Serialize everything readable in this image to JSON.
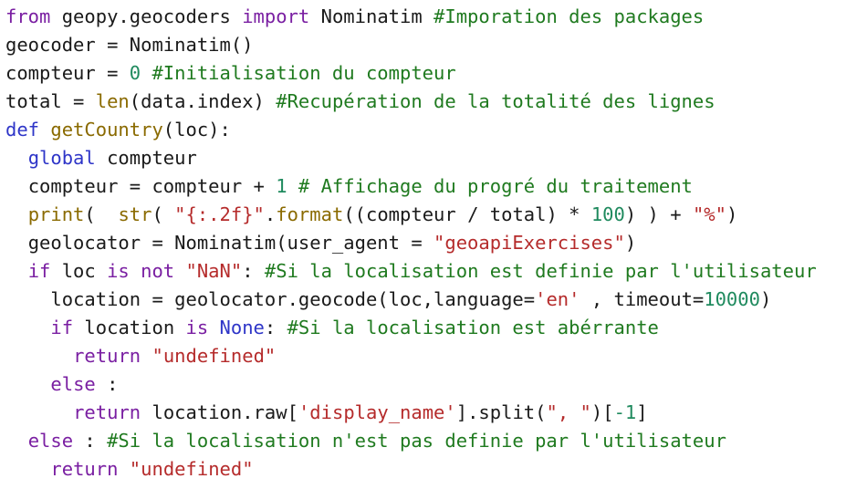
{
  "colors": {
    "plain": "#1a1a1a",
    "keyword": "#7a1fa2",
    "keyword2": "#2e35c8",
    "function": "#8a6a00",
    "string": "#b52b2b",
    "number": "#1f8a5e",
    "comment": "#1f7a1f"
  },
  "lines": [
    {
      "indent": 0,
      "tokens": [
        {
          "t": "kw",
          "v": "from"
        },
        {
          "t": "plain",
          "v": " geopy.geocoders "
        },
        {
          "t": "kw",
          "v": "import"
        },
        {
          "t": "plain",
          "v": " Nominatim "
        },
        {
          "t": "comment",
          "v": "#Imporation des packages"
        }
      ]
    },
    {
      "indent": 0,
      "tokens": [
        {
          "t": "plain",
          "v": "geocoder = Nominatim()"
        }
      ]
    },
    {
      "indent": 0,
      "tokens": [
        {
          "t": "plain",
          "v": "compteur = "
        },
        {
          "t": "num",
          "v": "0"
        },
        {
          "t": "plain",
          "v": " "
        },
        {
          "t": "comment",
          "v": "#Initialisation du compteur"
        }
      ]
    },
    {
      "indent": 0,
      "tokens": [
        {
          "t": "plain",
          "v": "total = "
        },
        {
          "t": "fn",
          "v": "len"
        },
        {
          "t": "plain",
          "v": "(data.index) "
        },
        {
          "t": "comment",
          "v": "#Recupération de la totalité des lignes"
        }
      ]
    },
    {
      "indent": 0,
      "tokens": [
        {
          "t": "kw2",
          "v": "def"
        },
        {
          "t": "plain",
          "v": " "
        },
        {
          "t": "fn",
          "v": "getCountry"
        },
        {
          "t": "plain",
          "v": "(loc):"
        }
      ]
    },
    {
      "indent": 1,
      "tokens": [
        {
          "t": "kw2",
          "v": "global"
        },
        {
          "t": "plain",
          "v": " compteur"
        }
      ]
    },
    {
      "indent": 1,
      "tokens": [
        {
          "t": "plain",
          "v": "compteur = compteur + "
        },
        {
          "t": "num",
          "v": "1"
        },
        {
          "t": "plain",
          "v": " "
        },
        {
          "t": "comment",
          "v": "# Affichage du progré du traitement"
        }
      ]
    },
    {
      "indent": 1,
      "tokens": [
        {
          "t": "fn",
          "v": "print"
        },
        {
          "t": "plain",
          "v": "(  "
        },
        {
          "t": "fn",
          "v": "str"
        },
        {
          "t": "plain",
          "v": "( "
        },
        {
          "t": "str",
          "v": "\"{:.2f}\""
        },
        {
          "t": "plain",
          "v": "."
        },
        {
          "t": "fn",
          "v": "format"
        },
        {
          "t": "plain",
          "v": "((compteur / total) * "
        },
        {
          "t": "num",
          "v": "100"
        },
        {
          "t": "plain",
          "v": ") ) + "
        },
        {
          "t": "str",
          "v": "\"%\""
        },
        {
          "t": "plain",
          "v": ")"
        }
      ]
    },
    {
      "indent": 1,
      "tokens": [
        {
          "t": "plain",
          "v": "geolocator = Nominatim(user_agent = "
        },
        {
          "t": "str",
          "v": "\"geoapiExercises\""
        },
        {
          "t": "plain",
          "v": ")"
        }
      ]
    },
    {
      "indent": 1,
      "tokens": [
        {
          "t": "kw",
          "v": "if"
        },
        {
          "t": "plain",
          "v": " loc "
        },
        {
          "t": "kw",
          "v": "is not"
        },
        {
          "t": "plain",
          "v": " "
        },
        {
          "t": "str",
          "v": "\"NaN\""
        },
        {
          "t": "plain",
          "v": ": "
        },
        {
          "t": "comment",
          "v": "#Si la localisation est definie par l'utilisateur"
        }
      ]
    },
    {
      "indent": 2,
      "tokens": [
        {
          "t": "plain",
          "v": "location = geolocator.geocode(loc,language="
        },
        {
          "t": "str",
          "v": "'en'"
        },
        {
          "t": "plain",
          "v": " , timeout="
        },
        {
          "t": "num",
          "v": "10000"
        },
        {
          "t": "plain",
          "v": ")"
        }
      ]
    },
    {
      "indent": 2,
      "tokens": [
        {
          "t": "kw",
          "v": "if"
        },
        {
          "t": "plain",
          "v": " location "
        },
        {
          "t": "kw",
          "v": "is"
        },
        {
          "t": "plain",
          "v": " "
        },
        {
          "t": "kw2",
          "v": "None"
        },
        {
          "t": "plain",
          "v": ": "
        },
        {
          "t": "comment",
          "v": "#Si la localisation est abérrante"
        }
      ]
    },
    {
      "indent": 3,
      "tokens": [
        {
          "t": "kw",
          "v": "return"
        },
        {
          "t": "plain",
          "v": " "
        },
        {
          "t": "str",
          "v": "\"undefined\""
        }
      ]
    },
    {
      "indent": 2,
      "tokens": [
        {
          "t": "kw",
          "v": "else"
        },
        {
          "t": "plain",
          "v": " :"
        }
      ]
    },
    {
      "indent": 3,
      "tokens": [
        {
          "t": "kw",
          "v": "return"
        },
        {
          "t": "plain",
          "v": " location.raw["
        },
        {
          "t": "str",
          "v": "'display_name'"
        },
        {
          "t": "plain",
          "v": "].split("
        },
        {
          "t": "str",
          "v": "\", \""
        },
        {
          "t": "plain",
          "v": ")["
        },
        {
          "t": "num",
          "v": "-1"
        },
        {
          "t": "plain",
          "v": "]"
        }
      ]
    },
    {
      "indent": 1,
      "tokens": [
        {
          "t": "kw",
          "v": "else"
        },
        {
          "t": "plain",
          "v": " : "
        },
        {
          "t": "comment",
          "v": "#Si la localisation n'est pas definie par l'utilisateur"
        }
      ]
    },
    {
      "indent": 2,
      "tokens": [
        {
          "t": "kw",
          "v": "return"
        },
        {
          "t": "plain",
          "v": " "
        },
        {
          "t": "str",
          "v": "\"undefined\""
        }
      ]
    }
  ]
}
